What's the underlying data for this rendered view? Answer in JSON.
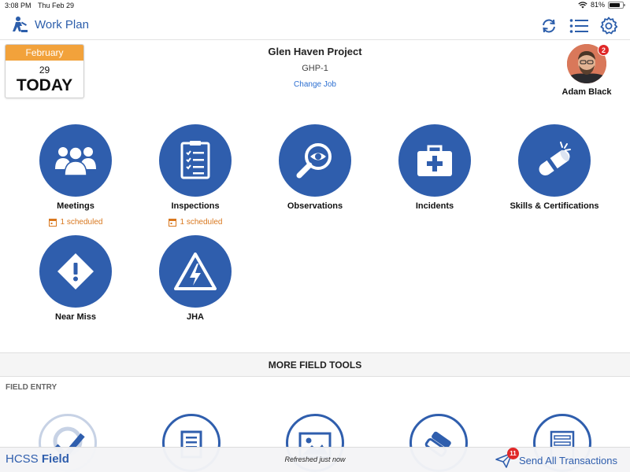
{
  "status_bar": {
    "time": "3:08 PM",
    "date": "Thu Feb 29",
    "battery": "81%",
    "battery_level": 0.81
  },
  "nav": {
    "title": "Work Plan",
    "icons": [
      "work-plan-icon",
      "sync-icon",
      "list-icon",
      "settings-icon"
    ]
  },
  "date_card": {
    "month": "February",
    "day": "29",
    "label": "TODAY",
    "accent": "#f2a23b"
  },
  "project": {
    "name": "Glen Haven Project",
    "code": "GHP-1",
    "change_label": "Change Job"
  },
  "user": {
    "name": "Adam Black",
    "badge": "2"
  },
  "tools": [
    {
      "label": "Meetings",
      "scheduled": "1 scheduled",
      "icon": "people-icon"
    },
    {
      "label": "Inspections",
      "scheduled": "1 scheduled",
      "icon": "checklist-icon"
    },
    {
      "label": "Observations",
      "scheduled": "",
      "icon": "magnifier-eye-icon"
    },
    {
      "label": "Incidents",
      "scheduled": "",
      "icon": "first-aid-kit-icon"
    },
    {
      "label": "Skills & Certifications",
      "scheduled": "",
      "icon": "diploma-icon"
    },
    {
      "label": "Near Miss",
      "scheduled": "",
      "icon": "warning-diamond-icon"
    },
    {
      "label": "JHA",
      "scheduled": "",
      "icon": "hazard-triangle-icon"
    }
  ],
  "more_tools": {
    "title": "MORE FIELD TOOLS",
    "section_label": "FIELD ENTRY"
  },
  "field_entry_icons": [
    "timecard-icon",
    "notes-icon",
    "photos-icon",
    "materials-icon",
    "forms-icon"
  ],
  "bottom_bar": {
    "brand_prefix": "HCSS",
    "brand_suffix": "Field",
    "refresh_text": "Refreshed just now",
    "send_label": "Send All Transactions",
    "send_badge": "11"
  },
  "colors": {
    "primary": "#2f5ead",
    "accent": "#d9781f",
    "badge": "#e02828"
  }
}
